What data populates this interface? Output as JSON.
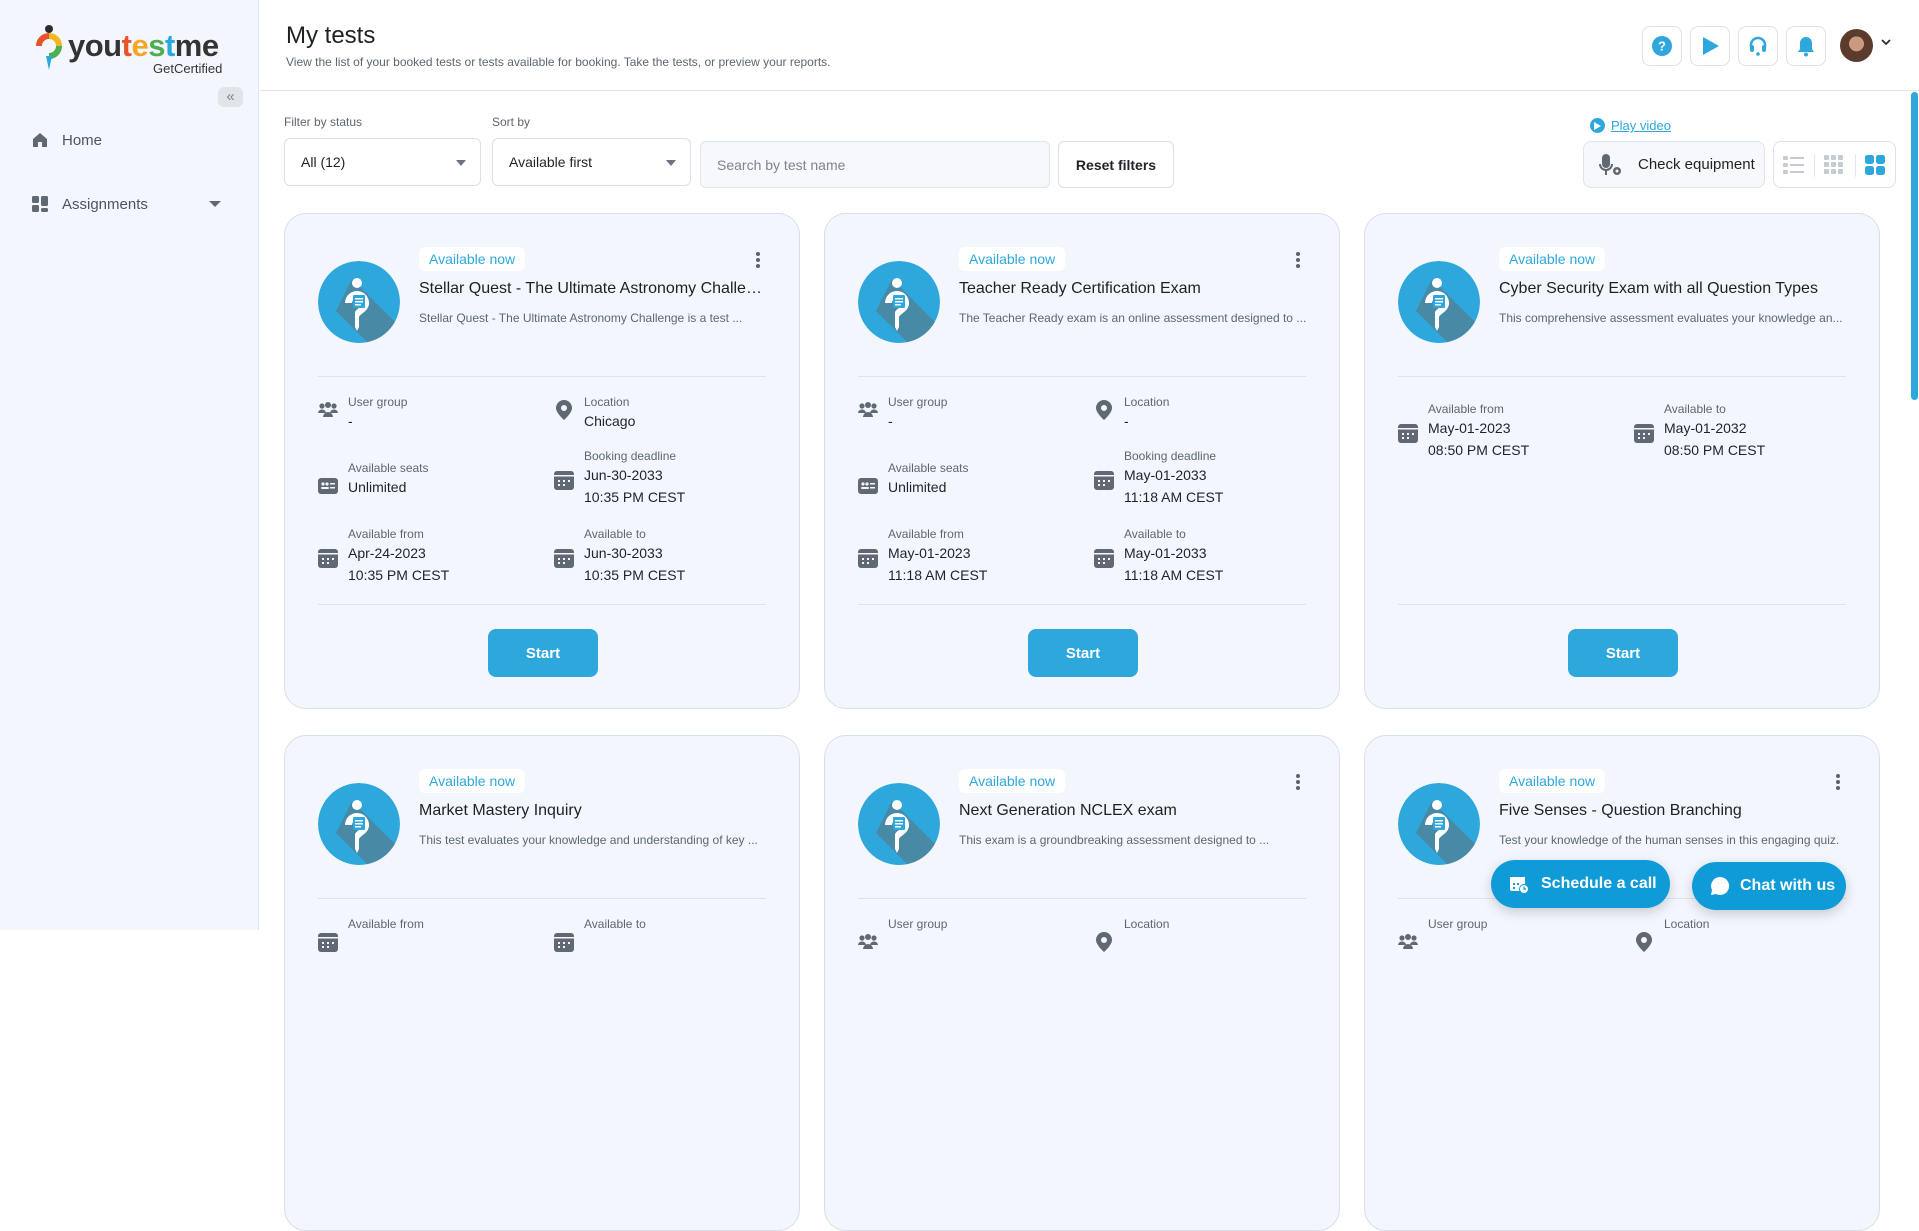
{
  "brand": {
    "name_parts": [
      "you",
      "t",
      "e",
      "s",
      "t",
      "me"
    ],
    "name_colors": [
      "#333333",
      "#e8532b",
      "#f5a623",
      "#4caf50",
      "#2aa7df",
      "#333333"
    ],
    "tagline": "GetCertified",
    "accent": "#2ea7dd"
  },
  "sidebar": {
    "collapse_glyph": "«",
    "items": [
      {
        "label": "Home",
        "icon": "home-icon"
      },
      {
        "label": "Assignments",
        "icon": "assignments-icon",
        "has_submenu": true
      }
    ]
  },
  "header": {
    "title": "My tests",
    "subtitle": "View the list of your booked tests or tests available for booking. Take the tests, or preview your reports.",
    "buttons": [
      {
        "name": "help",
        "icon": "help-icon"
      },
      {
        "name": "play",
        "icon": "play-icon"
      },
      {
        "name": "support",
        "icon": "headset-icon"
      },
      {
        "name": "notifications",
        "icon": "bell-icon"
      }
    ],
    "user_menu": {
      "icon": "avatar"
    }
  },
  "filters": {
    "status_label": "Filter by status",
    "status_value": "All (12)",
    "sort_label": "Sort by",
    "sort_value": "Available first",
    "search_placeholder": "Search by test name",
    "search_value": "",
    "reset_label": "Reset filters",
    "play_video_label": "Play video",
    "check_equipment_label": "Check equipment",
    "view_modes": [
      "list",
      "grid-small",
      "grid-large"
    ],
    "active_view": "grid-large"
  },
  "cards": [
    {
      "status": "Available now",
      "title": "Stellar Quest - The Ultimate Astronomy Challenge",
      "description": "Stellar Quest - The Ultimate Astronomy Challenge is a test ...",
      "has_menu": true,
      "fields": [
        {
          "label": "User group",
          "value": "-",
          "value2": "",
          "icon": "user-group-icon"
        },
        {
          "label": "Location",
          "value": "Chicago",
          "value2": "",
          "icon": "location-icon"
        },
        {
          "label": "Available seats",
          "value": "Unlimited",
          "value2": "",
          "icon": "seats-icon"
        },
        {
          "label": "Booking deadline",
          "value": "Jun-30-2033",
          "value2": "10:35 PM CEST",
          "icon": "calendar-icon"
        },
        {
          "label": "Available from",
          "value": "Apr-24-2023",
          "value2": "10:35 PM CEST",
          "icon": "calendar-icon"
        },
        {
          "label": "Available to",
          "value": "Jun-30-2033",
          "value2": "10:35 PM CEST",
          "icon": "calendar-icon"
        }
      ],
      "action_label": "Start"
    },
    {
      "status": "Available now",
      "title": "Teacher Ready Certification Exam",
      "description": "The Teacher Ready exam is an online assessment designed to ...",
      "has_menu": true,
      "fields": [
        {
          "label": "User group",
          "value": "-",
          "value2": "",
          "icon": "user-group-icon"
        },
        {
          "label": "Location",
          "value": "-",
          "value2": "",
          "icon": "location-icon"
        },
        {
          "label": "Available seats",
          "value": "Unlimited",
          "value2": "",
          "icon": "seats-icon"
        },
        {
          "label": "Booking deadline",
          "value": "May-01-2033",
          "value2": "11:18 AM CEST",
          "icon": "calendar-icon"
        },
        {
          "label": "Available from",
          "value": "May-01-2023",
          "value2": "11:18 AM CEST",
          "icon": "calendar-icon"
        },
        {
          "label": "Available to",
          "value": "May-01-2033",
          "value2": "11:18 AM CEST",
          "icon": "calendar-icon"
        }
      ],
      "action_label": "Start"
    },
    {
      "status": "Available now",
      "title": "Cyber Security Exam with all Question Types",
      "description": "This comprehensive assessment evaluates your knowledge an...",
      "has_menu": false,
      "fields": [
        {
          "label": "Available from",
          "value": "May-01-2023",
          "value2": "08:50 PM CEST",
          "icon": "calendar-icon"
        },
        {
          "label": "Available to",
          "value": "May-01-2032",
          "value2": "08:50 PM CEST",
          "icon": "calendar-icon"
        }
      ],
      "action_label": "Start"
    },
    {
      "status": "Available now",
      "title": "Market Mastery Inquiry",
      "description": "This test evaluates your knowledge and understanding of key ...",
      "has_menu": false,
      "fields": [
        {
          "label": "Available from",
          "value": "",
          "value2": "",
          "icon": "calendar-icon"
        },
        {
          "label": "Available to",
          "value": "",
          "value2": "",
          "icon": "calendar-icon"
        }
      ]
    },
    {
      "status": "Available now",
      "title": "Next Generation NCLEX exam",
      "description": "This exam is a groundbreaking assessment designed to ...",
      "has_menu": true,
      "fields": [
        {
          "label": "User group",
          "value": "",
          "value2": "",
          "icon": "user-group-icon"
        },
        {
          "label": "Location",
          "value": "",
          "value2": "",
          "icon": "location-icon"
        }
      ]
    },
    {
      "status": "Available now",
      "title": "Five Senses - Question Branching",
      "description": "Test your knowledge of the human senses in this engaging quiz.",
      "has_menu": true,
      "fields": [
        {
          "label": "User group",
          "value": "",
          "value2": "",
          "icon": "user-group-icon"
        },
        {
          "label": "Location",
          "value": "",
          "value2": "",
          "icon": "location-icon"
        }
      ]
    }
  ],
  "floating": {
    "schedule_label": "Schedule a call",
    "chat_label": "Chat with us"
  }
}
